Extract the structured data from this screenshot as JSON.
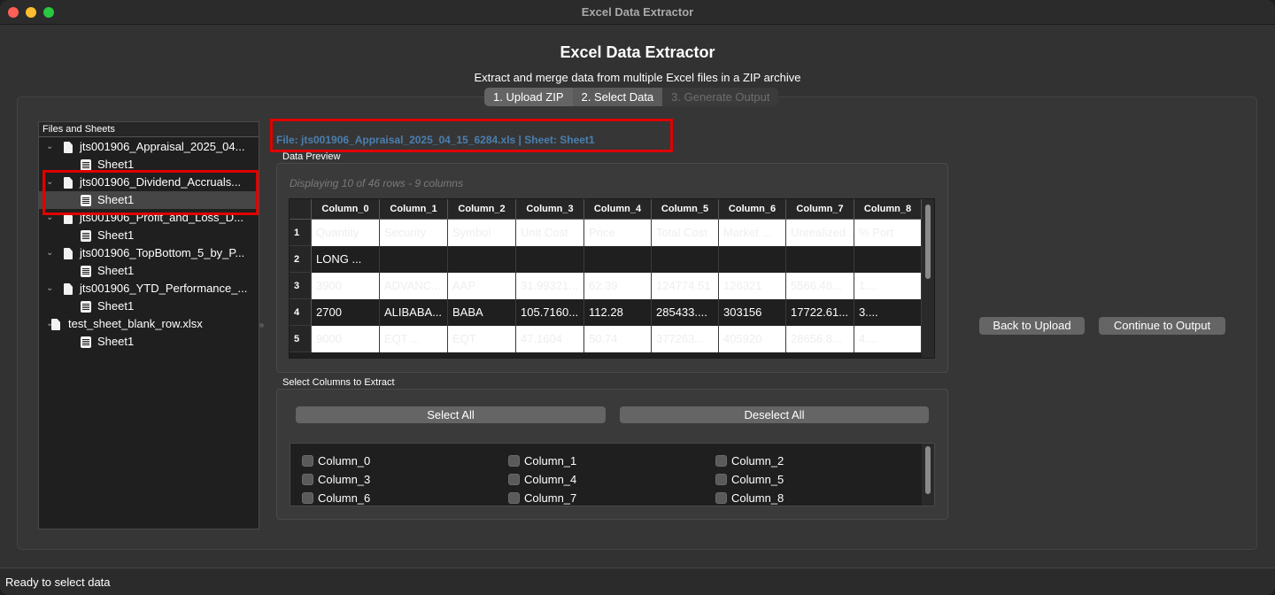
{
  "window": {
    "title": "Excel Data Extractor"
  },
  "header": {
    "title": "Excel Data Extractor",
    "subtitle": "Extract and merge data from multiple Excel files in a ZIP archive"
  },
  "tabs": [
    {
      "label": "1. Upload ZIP",
      "state": "normal"
    },
    {
      "label": "2. Select Data",
      "state": "selected"
    },
    {
      "label": "3. Generate Output",
      "state": "disabled"
    }
  ],
  "tree": {
    "header": "Files and Sheets",
    "items": [
      {
        "file": "jts001906_Appraisal_2025_04...",
        "sheet": "Sheet1"
      },
      {
        "file": "jts001906_Dividend_Accruals...",
        "sheet": "Sheet1"
      },
      {
        "file": "jts001906_Profit_and_Loss_D...",
        "sheet": "Sheet1"
      },
      {
        "file": "jts001906_TopBottom_5_by_P...",
        "sheet": "Sheet1"
      },
      {
        "file": "jts001906_YTD_Performance_...",
        "sheet": "Sheet1"
      },
      {
        "file": "test_sheet_blank_row.xlsx",
        "sheet": "Sheet1"
      }
    ]
  },
  "main": {
    "file_label": "File: jts001906_Appraisal_2025_04_15_6284.xls | Sheet: Sheet1",
    "preview": {
      "group_title": "Data Preview",
      "info": "Displaying 10 of 46 rows - 9 columns",
      "columns": [
        "Column_0",
        "Column_1",
        "Column_2",
        "Column_3",
        "Column_4",
        "Column_5",
        "Column_6",
        "Column_7",
        "Column_8"
      ],
      "rows": [
        [
          "Quantity",
          "Security",
          "Symbol",
          "Unit Cost",
          "Price",
          "Total Cost",
          "Market ...",
          "Unrealized ...",
          "% Port"
        ],
        [
          "LONG ...",
          "",
          "",
          "",
          "",
          "",
          "",
          "",
          ""
        ],
        [
          "3900",
          "ADVANC...",
          "AAP",
          "31.99321...",
          "62.39",
          "124774.51",
          "126321",
          "5566.48...",
          "1...."
        ],
        [
          "2700",
          "ALIBABA...",
          "BABA",
          "105.7160...",
          "112.28",
          "285433....",
          "303156",
          "17722.61...",
          "3...."
        ],
        [
          "9000",
          "EQT ...",
          "EQT",
          "47.1604",
          "50.74",
          "377263...",
          "405920",
          "28656.8...",
          "4...."
        ]
      ]
    },
    "columns_select": {
      "group_title": "Select Columns to Extract",
      "select_all": "Select All",
      "deselect_all": "Deselect All",
      "items": [
        "Column_0",
        "Column_1",
        "Column_2",
        "Column_3",
        "Column_4",
        "Column_5",
        "Column_6",
        "Column_7",
        "Column_8"
      ]
    }
  },
  "actions": {
    "back": "Back to Upload",
    "continue": "Continue to Output"
  },
  "status": {
    "text": "Ready to select data"
  },
  "colors": {
    "background": "#323232",
    "highlight": "#e00000",
    "file_label": "#4a7fb0",
    "button": "#656565"
  }
}
